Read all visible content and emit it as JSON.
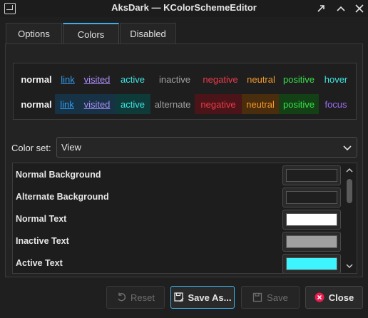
{
  "window": {
    "title": "AksDark — KColorSchemeEditor"
  },
  "tabs": [
    {
      "label": "Options"
    },
    {
      "label": "Colors"
    },
    {
      "label": "Disabled"
    }
  ],
  "preview": {
    "row1": [
      "normal",
      "link",
      "visited",
      "active",
      "inactive",
      "negative",
      "neutral",
      "positive",
      "hover"
    ],
    "row2": [
      "normal",
      "link",
      "visited",
      "active",
      "alternate",
      "negative",
      "neutral",
      "positive",
      "focus"
    ],
    "colors": {
      "normal": "#f2f2f2",
      "link": "#2f9bf0",
      "visited": "#a98cf5",
      "active": "#3ee5e0",
      "inactive": "#a0a0a0",
      "alternate": "#a0a0a0",
      "negative": "#ee3a4a",
      "neutral": "#f29a2a",
      "positive": "#36e04a",
      "hover": "#3ee5e0",
      "focus": "#9a6cf0"
    },
    "row2_backgrounds": {
      "link": "#173244",
      "visited": "#173244",
      "active": "#0f3a3a",
      "negative": "#4a1418",
      "neutral": "#4a2d0c",
      "positive": "#134015"
    }
  },
  "colorset": {
    "label": "Color set:",
    "selected": "View"
  },
  "color_roles": [
    {
      "name": "Normal Background",
      "color": "#1f1f1f"
    },
    {
      "name": "Alternate Background",
      "color": "#1f1f1f"
    },
    {
      "name": "Normal Text",
      "color": "#ffffff"
    },
    {
      "name": "Inactive Text",
      "color": "#a0a0a0"
    },
    {
      "name": "Active Text",
      "color": "#3ef5ff"
    }
  ],
  "buttons": {
    "reset": "Reset",
    "save_as": "Save As...",
    "save": "Save",
    "close": "Close"
  }
}
